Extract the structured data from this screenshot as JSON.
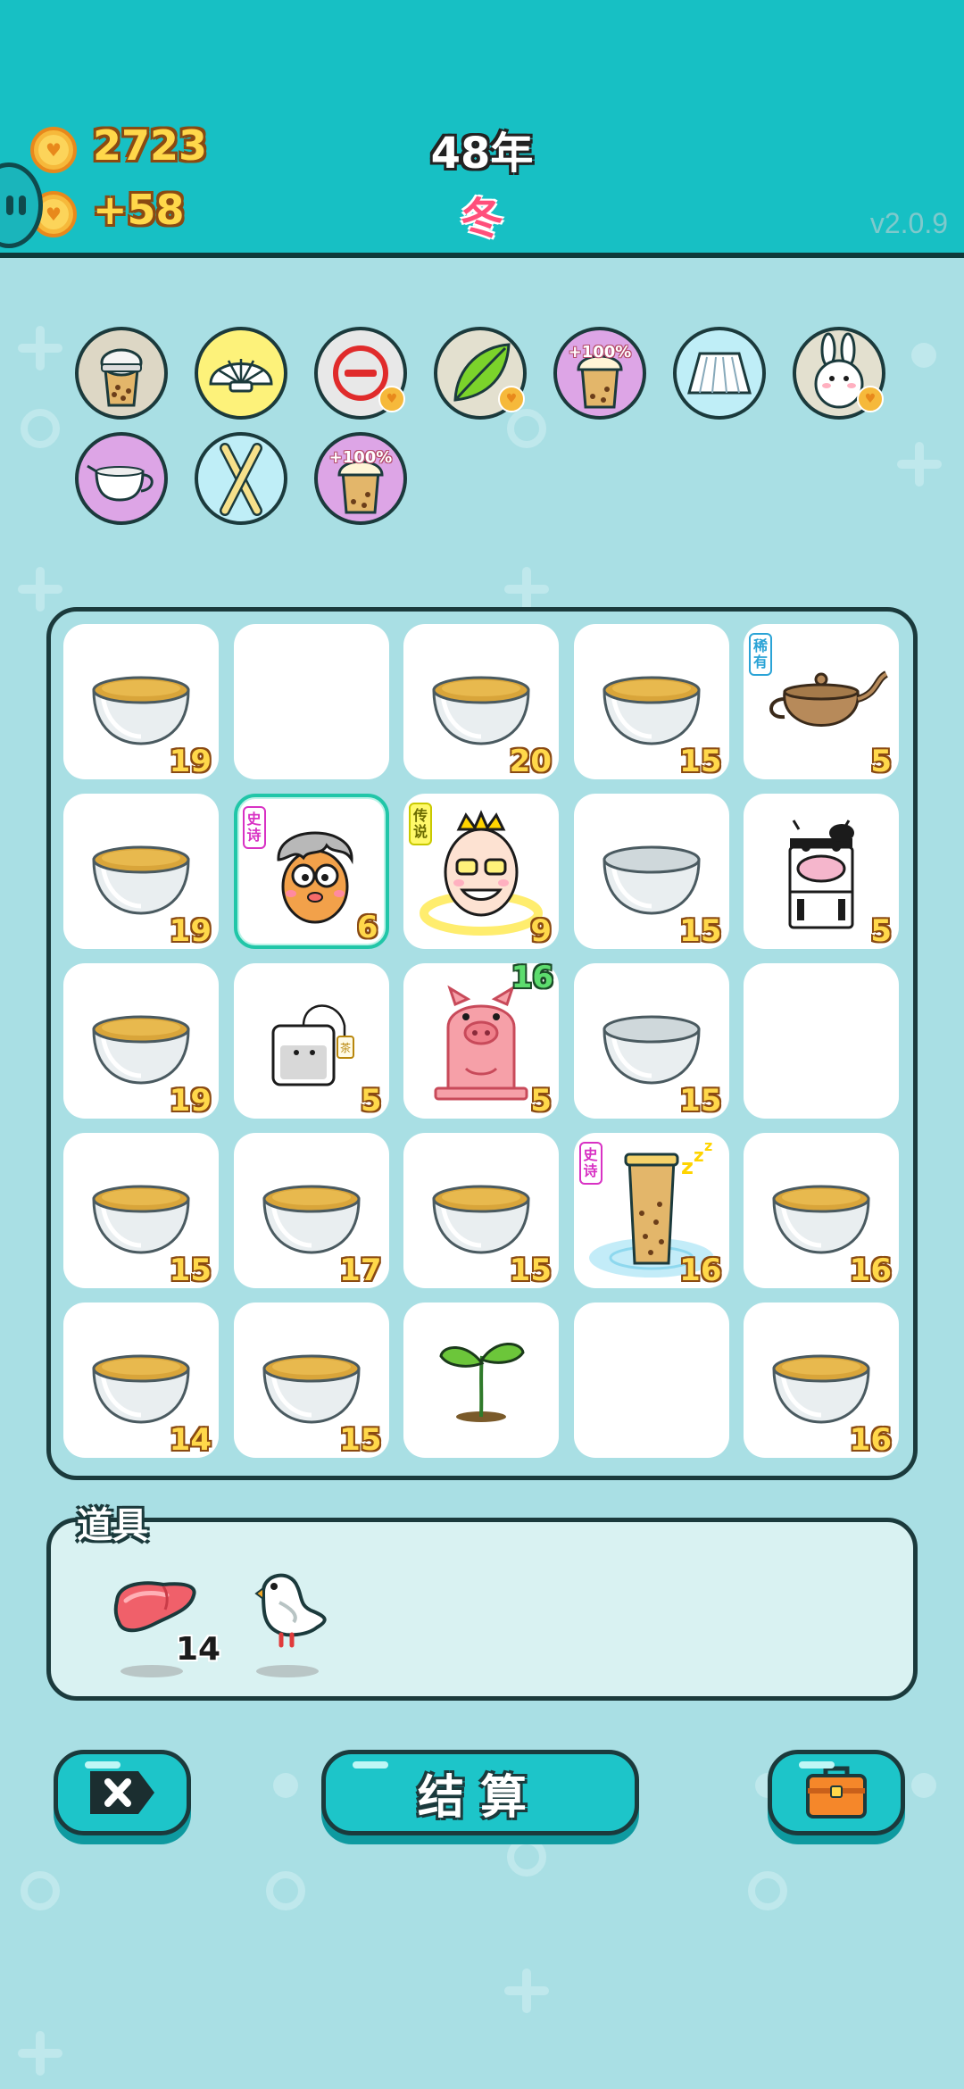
{
  "header": {
    "coins": "2723",
    "income": "+58",
    "year": "48年",
    "season": "冬",
    "version": "v2.0.9"
  },
  "buffs": [
    {
      "name": "bubble-tea-lid",
      "bg": "#ddd7c5"
    },
    {
      "name": "shell",
      "bg": "#fdf27a"
    },
    {
      "name": "minus-sign",
      "bg": "#e8e8e8"
    },
    {
      "name": "tea-leaf",
      "bg": "#e3e0cf"
    },
    {
      "name": "cup-boost",
      "bg": "#dda5e6",
      "label": "+100%"
    },
    {
      "name": "skirt",
      "bg": "#bfeef7"
    },
    {
      "name": "rabbit",
      "bg": "#e3e0cf"
    },
    {
      "name": "milk-jug",
      "bg": "#dda5e6"
    },
    {
      "name": "straws",
      "bg": "#bfeef7"
    },
    {
      "name": "cup-boost-2",
      "bg": "#dda5e6",
      "label": "+100%"
    }
  ],
  "board": {
    "cells": [
      {
        "item": "tea-bowl",
        "count": "19"
      },
      {
        "item": "empty",
        "count": ""
      },
      {
        "item": "tea-bowl",
        "count": "20"
      },
      {
        "item": "tea-bowl",
        "count": "15"
      },
      {
        "item": "teapot",
        "count": "5",
        "tag": "稀有"
      },
      {
        "item": "tea-bowl",
        "count": "19"
      },
      {
        "item": "old-man-character",
        "count": "6",
        "tag": "史诗"
      },
      {
        "item": "king-character",
        "count": "9",
        "tag": "传说"
      },
      {
        "item": "empty-bowl",
        "count": "15"
      },
      {
        "item": "cow",
        "count": "5"
      },
      {
        "item": "tea-bowl",
        "count": "19"
      },
      {
        "item": "tea-bag",
        "count": "5",
        "tag_small": "茶"
      },
      {
        "item": "pig",
        "count": "5",
        "top_count": "16"
      },
      {
        "item": "empty-bowl",
        "count": "15"
      },
      {
        "item": "empty",
        "count": ""
      },
      {
        "item": "tea-bowl",
        "count": "15"
      },
      {
        "item": "tea-bowl",
        "count": "17"
      },
      {
        "item": "tea-bowl",
        "count": "15"
      },
      {
        "item": "boba-cup",
        "count": "16",
        "tag": "史诗"
      },
      {
        "item": "tea-bowl",
        "count": "16"
      },
      {
        "item": "tea-bowl",
        "count": "14"
      },
      {
        "item": "tea-bowl",
        "count": "15"
      },
      {
        "item": "sprout",
        "count": ""
      },
      {
        "item": "empty",
        "count": ""
      },
      {
        "item": "tea-bowl",
        "count": "16"
      }
    ]
  },
  "items": {
    "title": "道具",
    "list": [
      {
        "name": "liver",
        "count": "14"
      },
      {
        "name": "white-bird",
        "count": ""
      }
    ]
  },
  "buttons": {
    "settle_label": "结算"
  },
  "colors": {
    "header": "#17c0c4",
    "background": "#a9dfe4",
    "accent": "#1dc5c9"
  }
}
